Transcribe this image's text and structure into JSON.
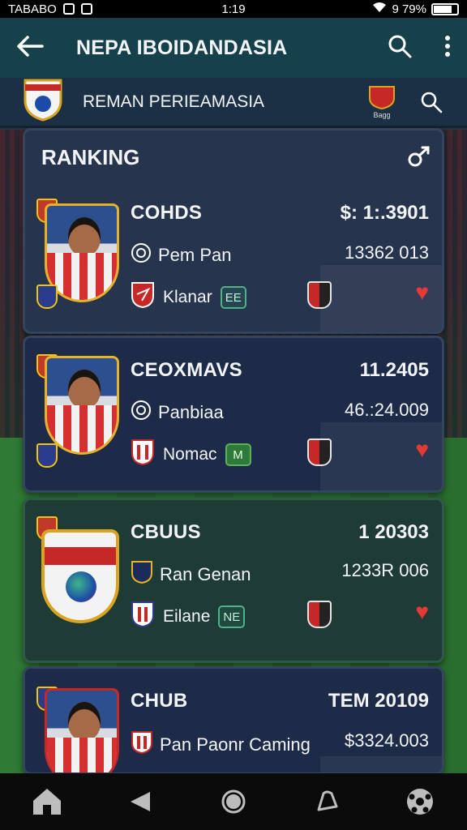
{
  "status_bar": {
    "left_text": "TABABO",
    "time": "1:19",
    "battery": "9 79%"
  },
  "app_bar": {
    "title": "NEPA IBOIDANDASIA"
  },
  "sub_header": {
    "label": "REMAN PERIEAMASIA",
    "club_label": "Bagg"
  },
  "ranking": {
    "title": "RANKING"
  },
  "entries": [
    {
      "name": "COHDS",
      "value": "$: 1:.3901",
      "sub_label": "Pem Pan",
      "sub_value": "13362 013",
      "meta_label": "Klanar",
      "tag": "EE"
    },
    {
      "name": "CEOXMAVS",
      "value": "11.2405",
      "sub_label": "Panbiaa",
      "sub_value": "46.:24.009",
      "meta_label": "Nomac",
      "tag": "M"
    },
    {
      "name": "CBUUS",
      "value": "1 20303",
      "sub_label": "Ran Genan",
      "sub_value": "1233R 006",
      "meta_label": "Eilane",
      "tag": "NE"
    },
    {
      "name": "CHUB",
      "value": "TEM 20109",
      "sub_label": "Pan Paonr Caming",
      "sub_value": "$3324.003"
    }
  ],
  "colors": {
    "app_bar": "#16404a",
    "heart": "#e53935",
    "accent_gold": "#e8b12a"
  }
}
